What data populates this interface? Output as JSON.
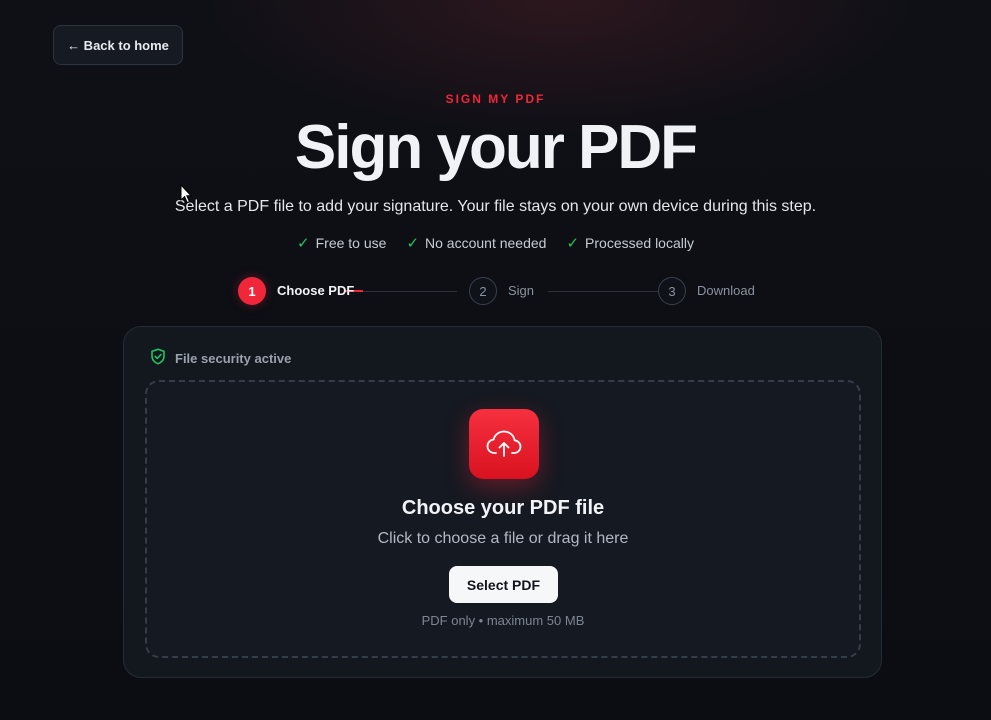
{
  "nav": {
    "back_label": "← Back to home"
  },
  "hero": {
    "eyebrow": "SIGN MY PDF",
    "title": "Sign your PDF",
    "subtitle": "Select a PDF file to add your signature. Your file stays on your own device during this step."
  },
  "badges": [
    {
      "icon": "check-icon",
      "label": "Free to use"
    },
    {
      "icon": "check-icon",
      "label": "No account needed"
    },
    {
      "icon": "check-icon",
      "label": "Processed locally"
    }
  ],
  "stepper": {
    "steps": [
      {
        "number": "1",
        "label": "Choose PDF",
        "state": "active"
      },
      {
        "number": "2",
        "label": "Sign",
        "state": "inactive"
      },
      {
        "number": "3",
        "label": "Download",
        "state": "inactive"
      }
    ]
  },
  "card": {
    "security_label": "File security active",
    "dropzone": {
      "icon": "cloud-upload-icon",
      "title": "Choose your PDF file",
      "subtitle": "Click to choose a file or drag it here",
      "button_label": "Select PDF",
      "note": "PDF only • maximum 50 MB"
    }
  },
  "colors": {
    "accent": "#f0263a",
    "success": "#22c55e",
    "background": "#0b0d12",
    "card": "#13171e"
  }
}
